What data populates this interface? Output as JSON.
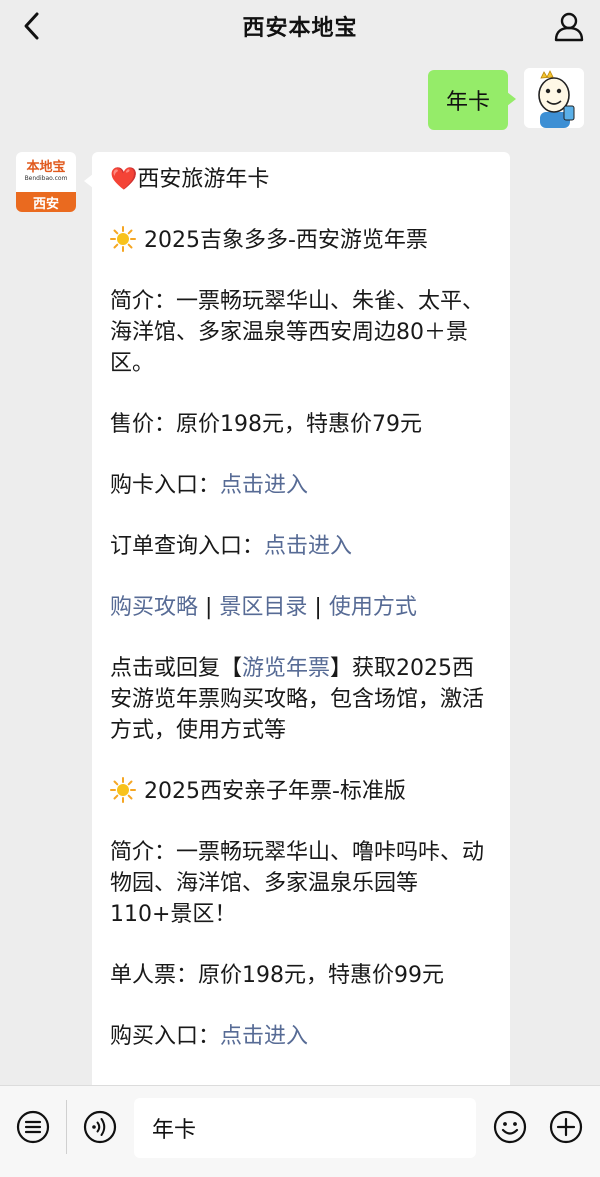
{
  "header": {
    "title": "西安本地宝"
  },
  "outgoing": {
    "text": "年卡"
  },
  "incoming": {
    "avatar_logo_main": "本地宝",
    "avatar_logo_sub": "Bendibao.com",
    "avatar_city": "西安",
    "heading": "西安旅游年卡",
    "item1_title": "2025吉象多多-西安游览年票",
    "item1_intro": "简介：一票畅玩翠华山、朱雀、太平、海洋馆、多家温泉等西安周边80＋景区。",
    "item1_price": "售价：原价198元，特惠价79元",
    "item1_buy_label": "购卡入口：",
    "item1_buy_link": "点击进入",
    "item1_order_label": "订单查询入口：",
    "item1_order_link": "点击进入",
    "links": {
      "guide": "购买攻略",
      "sep1": " | ",
      "scenic": "景区目录",
      "sep2": " | ",
      "usage": "使用方式"
    },
    "reply_prefix": "点击或回复【",
    "reply_keyword": "游览年票",
    "reply_suffix": "】获取2025西安游览年票购买攻略，包含场馆，激活方式，使用方式等",
    "item2_title": "2025西安亲子年票-标准版",
    "item2_intro": "简介：一票畅玩翠华山、噜咔吗咔、动物园、海洋馆、多家温泉乐园等110+景区！",
    "item2_price": "单人票：原价198元，特惠价99元",
    "item2_buy_label": "购买入口：",
    "item2_buy_link": "点击进入"
  },
  "input_bar": {
    "value": "年卡"
  },
  "icons": {
    "back": "chevron-left-icon",
    "profile": "person-icon",
    "menu": "menu-list-icon",
    "voice": "voice-icon",
    "emoji": "smiley-icon",
    "plus": "plus-icon"
  },
  "colors": {
    "background": "#ededed",
    "outgoing_bubble": "#95ec69",
    "link": "#576b95",
    "brand_orange": "#ea6a1f"
  }
}
